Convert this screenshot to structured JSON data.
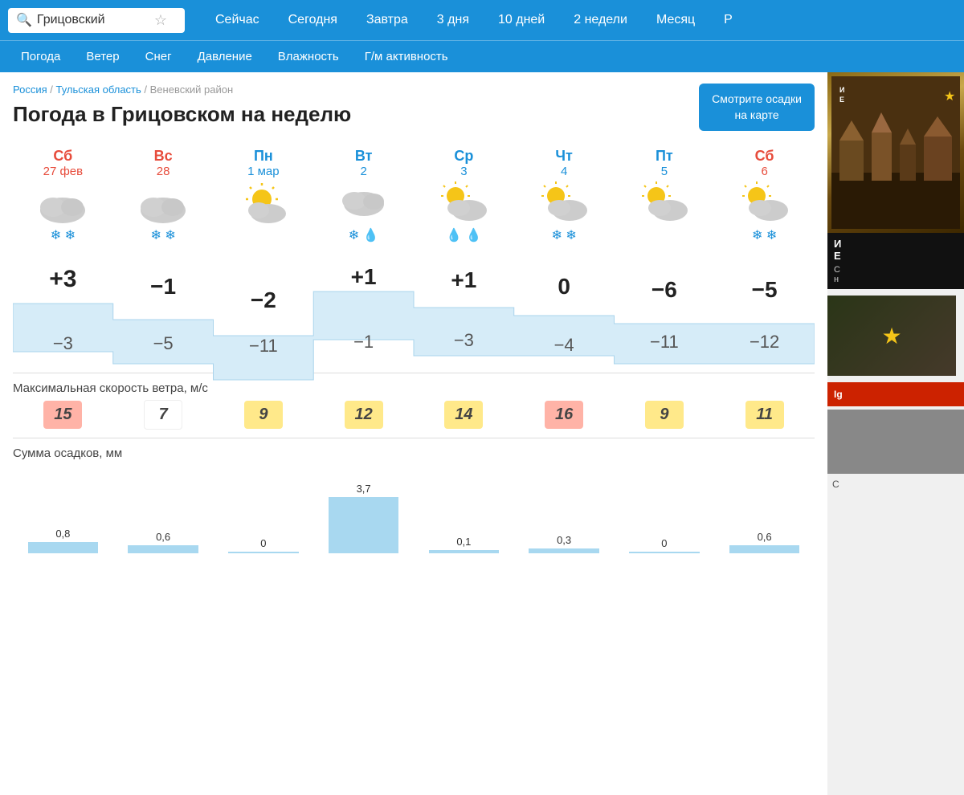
{
  "search": {
    "value": "Грицовский",
    "placeholder": "Грицовский"
  },
  "nav": {
    "links": [
      "Сейчас",
      "Сегодня",
      "Завтра",
      "3 дня",
      "10 дней",
      "2 недели",
      "Месяц",
      "Р"
    ]
  },
  "subnav": {
    "links": [
      "Погода",
      "Ветер",
      "Снег",
      "Давление",
      "Влажность",
      "Г/м активность"
    ]
  },
  "breadcrumb": {
    "items": [
      "Россия",
      "Тульская область",
      "Веневский район"
    ]
  },
  "page": {
    "title": "Погода в Грицовском на неделю",
    "map_button": "Смотрите осадки\nна карте"
  },
  "days": [
    {
      "name": "Сб",
      "date": "27 фев",
      "type": "weekend",
      "icon": "cloudy",
      "precip": [
        "snow",
        "snow"
      ],
      "temp_hi": "+3",
      "temp_lo": "−3"
    },
    {
      "name": "Вс",
      "date": "28",
      "type": "weekend",
      "icon": "cloudy",
      "precip": [
        "snow",
        "snow"
      ],
      "temp_hi": "−1",
      "temp_lo": "−5"
    },
    {
      "name": "Пн",
      "date": "1 мар",
      "type": "weekday",
      "icon": "partly",
      "precip": [],
      "temp_hi": "−2",
      "temp_lo": "−11"
    },
    {
      "name": "Вт",
      "date": "2",
      "type": "weekday",
      "icon": "cloudy",
      "precip": [
        "snow",
        "rain"
      ],
      "temp_hi": "+1",
      "temp_lo": "−1"
    },
    {
      "name": "Ср",
      "date": "3",
      "type": "weekday",
      "icon": "partly",
      "precip": [
        "rain",
        "rain"
      ],
      "temp_hi": "+1",
      "temp_lo": "−3"
    },
    {
      "name": "Чт",
      "date": "4",
      "type": "weekday",
      "icon": "partly",
      "precip": [
        "snow",
        "snow"
      ],
      "temp_hi": "0",
      "temp_lo": "−4"
    },
    {
      "name": "Пт",
      "date": "5",
      "type": "weekday",
      "icon": "partly",
      "precip": [],
      "temp_hi": "−6",
      "temp_lo": "−11"
    },
    {
      "name": "Сб",
      "date": "6",
      "type": "weekend",
      "icon": "partly",
      "precip": [
        "snow",
        "snow"
      ],
      "temp_hi": "−5",
      "temp_lo": "−12"
    }
  ],
  "wind": {
    "label": "Максимальная скорость ветра, м/с",
    "values": [
      "15",
      "7",
      "9",
      "12",
      "14",
      "16",
      "9",
      "11"
    ],
    "levels": [
      "high",
      "low",
      "med",
      "med",
      "med",
      "high",
      "med",
      "med"
    ]
  },
  "precip": {
    "label": "Сумма осадков, мм",
    "values": [
      "0,8",
      "0,6",
      "0",
      "3,7",
      "0,1",
      "0,3",
      "0",
      "0,6"
    ]
  },
  "colors": {
    "blue": "#1a90d9",
    "red": "#e74c3c",
    "band": "#d6ecf8"
  }
}
